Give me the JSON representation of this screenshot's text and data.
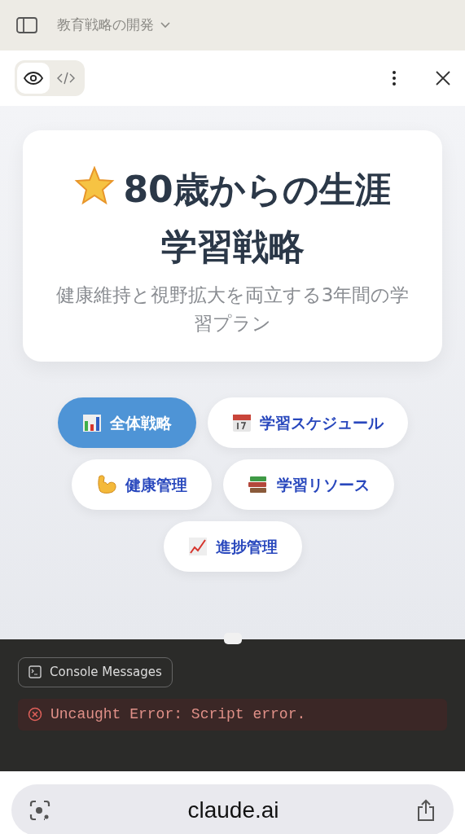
{
  "header": {
    "chat_title": "教育戦略の開発"
  },
  "view_toggle": [
    {
      "kind": "preview",
      "selected": true
    },
    {
      "kind": "code",
      "selected": false
    }
  ],
  "hero": {
    "title": "80歳からの生涯学習戦略",
    "subtitle": "健康維持と視野拡大を両立する3年間の学習プラン"
  },
  "tabs": [
    {
      "label": "全体戦略",
      "selected": true
    },
    {
      "label": "学習スケジュール",
      "selected": false
    },
    {
      "label": "健康管理",
      "selected": false
    },
    {
      "label": "学習リソース",
      "selected": false
    },
    {
      "label": "進捗管理",
      "selected": false
    }
  ],
  "console": {
    "button": "Console Messages",
    "messages": [
      {
        "kind": "error",
        "text": "Uncaught Error: Script error."
      }
    ]
  },
  "browser": {
    "address": "claude.ai"
  }
}
